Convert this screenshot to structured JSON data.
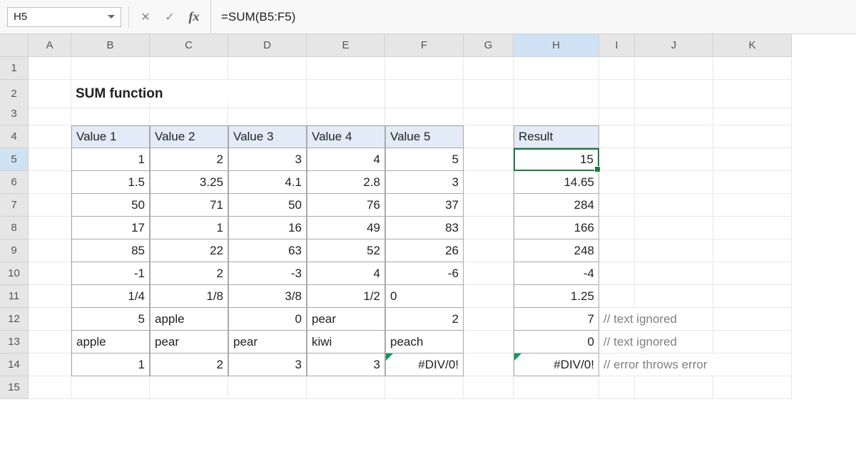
{
  "formula_bar": {
    "active_cell": "H5",
    "formula": "=SUM(B5:F5)"
  },
  "columns": [
    "A",
    "B",
    "C",
    "D",
    "E",
    "F",
    "G",
    "H",
    "I",
    "J",
    "K"
  ],
  "rows": [
    "1",
    "2",
    "3",
    "4",
    "5",
    "6",
    "7",
    "8",
    "9",
    "10",
    "11",
    "12",
    "13",
    "14",
    "15"
  ],
  "title": "SUM function",
  "headers": {
    "v1": "Value 1",
    "v2": "Value 2",
    "v3": "Value 3",
    "v4": "Value 4",
    "v5": "Value 5",
    "result": "Result"
  },
  "data": {
    "r5": {
      "b": "1",
      "c": "2",
      "d": "3",
      "e": "4",
      "f": "5",
      "h": "15"
    },
    "r6": {
      "b": "1.5",
      "c": "3.25",
      "d": "4.1",
      "e": "2.8",
      "f": "3",
      "h": "14.65"
    },
    "r7": {
      "b": "50",
      "c": "71",
      "d": "50",
      "e": "76",
      "f": "37",
      "h": "284"
    },
    "r8": {
      "b": "17",
      "c": "1",
      "d": "16",
      "e": "49",
      "f": "83",
      "h": "166"
    },
    "r9": {
      "b": "85",
      "c": "22",
      "d": "63",
      "e": "52",
      "f": "26",
      "h": "248"
    },
    "r10": {
      "b": "-1",
      "c": "2",
      "d": "-3",
      "e": "4",
      "f": "-6",
      "h": "-4"
    },
    "r11": {
      "b": "1/4",
      "c": "1/8",
      "d": "3/8",
      "e": "1/2",
      "f": "0",
      "h": "1.25"
    },
    "r12": {
      "b": "5",
      "c": "apple",
      "d": "0",
      "e": "pear",
      "f": "2",
      "h": "7"
    },
    "r13": {
      "b": "apple",
      "c": "pear",
      "d": "pear",
      "e": "kiwi",
      "f": "peach",
      "h": "0"
    },
    "r14": {
      "b": "1",
      "c": "2",
      "d": "3",
      "e": "3",
      "f": "#DIV/0!",
      "h": "#DIV/0!"
    }
  },
  "notes": {
    "n12": "// text ignored",
    "n13": "// text ignored",
    "n14": "// error throws error"
  },
  "chart_data": {
    "type": "table",
    "title": "SUM function",
    "columns": [
      "Value 1",
      "Value 2",
      "Value 3",
      "Value 4",
      "Value 5",
      "Result"
    ],
    "rows": [
      [
        1,
        2,
        3,
        4,
        5,
        15
      ],
      [
        1.5,
        3.25,
        4.1,
        2.8,
        3,
        14.65
      ],
      [
        50,
        71,
        50,
        76,
        37,
        284
      ],
      [
        17,
        1,
        16,
        49,
        83,
        166
      ],
      [
        85,
        22,
        63,
        52,
        26,
        248
      ],
      [
        -1,
        2,
        -3,
        4,
        -6,
        -4
      ],
      [
        0.25,
        0.125,
        0.375,
        0.5,
        0,
        1.25
      ],
      [
        5,
        "apple",
        0,
        "pear",
        2,
        7
      ],
      [
        "apple",
        "pear",
        "pear",
        "kiwi",
        "peach",
        0
      ],
      [
        1,
        2,
        3,
        3,
        "#DIV/0!",
        "#DIV/0!"
      ]
    ]
  }
}
